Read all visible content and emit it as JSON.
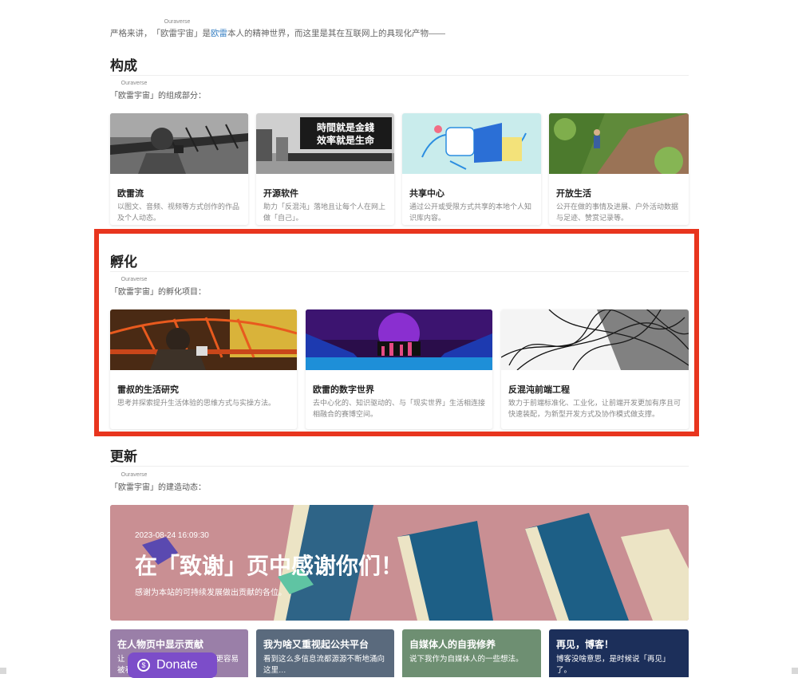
{
  "intro": {
    "prefix": "严格来讲，",
    "ruby": "Ouraverse",
    "name": "「欧雷宇宙」",
    "mid": "是",
    "link": "欧雷",
    "suffix": "本人的精神世界，而这里是其在互联网上的具现化产物——"
  },
  "sections": {
    "composition": {
      "heading": "构成",
      "ruby": "Ouraverse",
      "name": "「欧雷宇宙」",
      "sub": "的组成部分：",
      "cards": [
        {
          "title": "欧雷流",
          "desc": "以图文、音频、视频等方式创作的作品及个人动态。"
        },
        {
          "title": "开源软件",
          "desc": "助力「反混沌」落地且让每个人在网上做「自己」。"
        },
        {
          "title": "共享中心",
          "desc": "通过公开或受限方式共享的本地个人知识库内容。"
        },
        {
          "title": "开放生活",
          "desc": "公开在做的事情及进展、户外活动数据与足迹、赞赏记录等。"
        }
      ]
    },
    "incubation": {
      "heading": "孵化",
      "ruby": "Ouraverse",
      "name": "「欧雷宇宙」",
      "sub": "的孵化项目：",
      "cards": [
        {
          "title": "雷叔的生活研究",
          "desc": "思考并探索提升生活体验的思维方式与实操方法。"
        },
        {
          "title": "欧雷的数字世界",
          "desc": "去中心化的、知识驱动的、与「现实世界」生活相连接相融合的赛博空间。"
        },
        {
          "title": "反混沌前端工程",
          "desc": "致力于前端标准化、工业化，让前端开发更加有序且可快速装配，为新型开发方式及协作模式做支撑。"
        }
      ]
    },
    "updates": {
      "heading": "更新",
      "ruby": "Ouraverse",
      "name": "「欧雷宇宙」",
      "sub": "的建造动态：",
      "banner": {
        "date": "2023-08-24 16:09:30",
        "title": "在「致谢」页中感谢你们！",
        "desc": "感谢为本站的可持续发展做出贡献的各位。"
      },
      "minis": [
        {
          "title": "在人物页中显示贡献",
          "desc": "让「股东」和共建者们的付出更容易被看到。"
        },
        {
          "title": "我为啥又重视起公共平台",
          "desc": "看到这么多信息流都源源不断地涌向这里…"
        },
        {
          "title": "自媒体人的自我修养",
          "desc": "说下我作为自媒体人的一些想法。"
        },
        {
          "title": "再见，博客！",
          "desc": "博客没啥意思，是时候说「再见」了。"
        }
      ]
    }
  },
  "donate": {
    "label": "Donate",
    "icon": "coin-icon"
  },
  "colors": {
    "accent": "#e8351e",
    "link": "#3b82c4",
    "donate": "#7c4dc9"
  }
}
